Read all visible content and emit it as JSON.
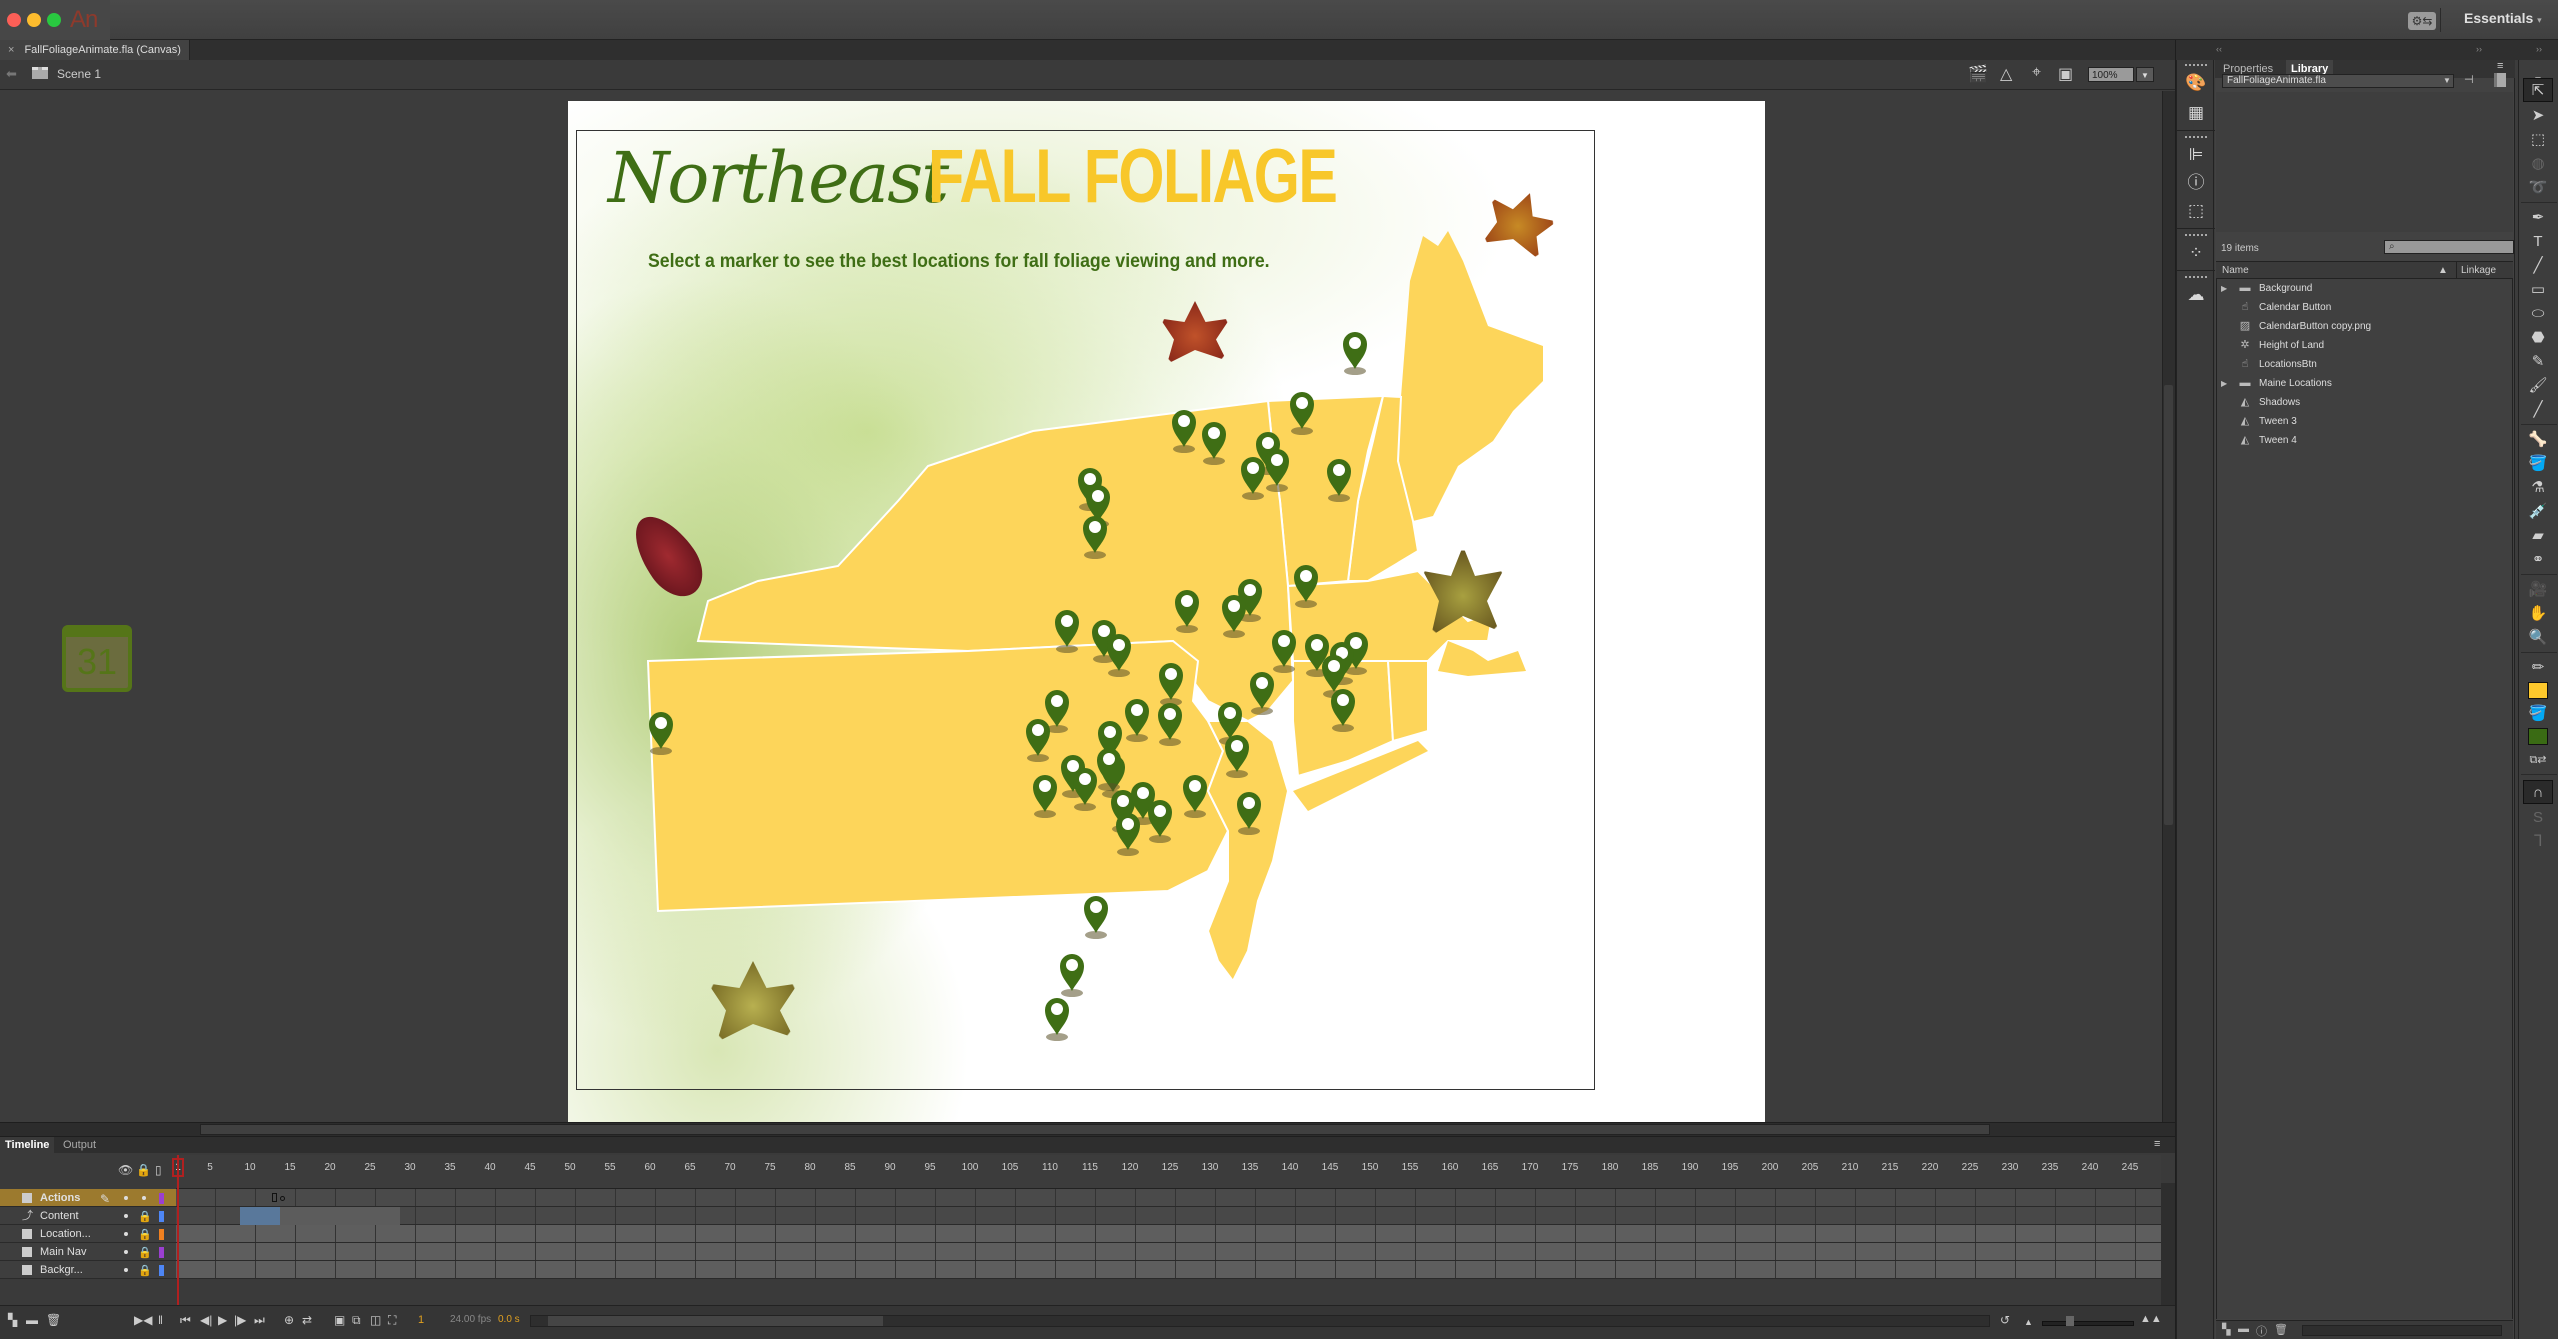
{
  "app": {
    "logo": "An",
    "workspace": "Essentials",
    "sync_icon": "sync-settings-icon"
  },
  "document": {
    "tab_label": "FallFoliageAnimate.fla (Canvas)",
    "scene": "Scene 1",
    "zoom": "100%"
  },
  "stage": {
    "title_script": "Northeast",
    "title_bold": "FALL FOLIAGE",
    "subtitle": "Select a marker to see the best locations for fall foliage viewing and more.",
    "colors": {
      "map_fill": "#fdd55a",
      "marker_green": "#3f6e15",
      "title_yellow": "#f8c72a"
    },
    "marker_count": 47
  },
  "panels": {
    "tabs": [
      "Properties",
      "Library"
    ],
    "active_tab": "Library",
    "library": {
      "document": "FallFoliageAnimate.fla",
      "item_count": "19 items",
      "search_placeholder": "",
      "columns": [
        "Name",
        "Linkage"
      ],
      "items": [
        {
          "name": "Background",
          "type": "folder",
          "expandable": true
        },
        {
          "name": "Calendar Button",
          "type": "button"
        },
        {
          "name": "CalendarButton copy.png",
          "type": "bitmap"
        },
        {
          "name": "Height of Land",
          "type": "movie-clip"
        },
        {
          "name": "LocationsBtn",
          "type": "button"
        },
        {
          "name": "Maine Locations",
          "type": "folder",
          "expandable": true
        },
        {
          "name": "Shadows",
          "type": "graphic"
        },
        {
          "name": "Tween 3",
          "type": "graphic"
        },
        {
          "name": "Tween 4",
          "type": "graphic"
        }
      ]
    }
  },
  "timeline": {
    "tabs": [
      "Timeline",
      "Output"
    ],
    "active_tab": "Timeline",
    "ruler_ticks": [
      "1",
      "5",
      "10",
      "15",
      "20",
      "25",
      "30",
      "35",
      "40",
      "45",
      "50",
      "55",
      "60",
      "65",
      "70",
      "75",
      "80",
      "85",
      "90",
      "95",
      "100",
      "105",
      "110",
      "115",
      "120",
      "125",
      "130",
      "135",
      "140",
      "145",
      "150",
      "155",
      "160",
      "165",
      "170",
      "175",
      "180",
      "185",
      "190",
      "195",
      "200",
      "205",
      "210",
      "215",
      "220",
      "225",
      "230",
      "235",
      "240",
      "245"
    ],
    "layers": [
      {
        "name": "Actions",
        "color": "#9b3fd0",
        "selected": true,
        "locked": false
      },
      {
        "name": "Content",
        "color": "#4e86f5",
        "selected": false,
        "locked": true
      },
      {
        "name": "Location...",
        "color": "#f08020",
        "selected": false,
        "locked": true
      },
      {
        "name": "Main Nav",
        "color": "#9b3fd0",
        "selected": false,
        "locked": true
      },
      {
        "name": "Backgr...",
        "color": "#4e86f5",
        "selected": false,
        "locked": true
      }
    ],
    "current_frame": "1",
    "fps": "24.00 fps",
    "elapsed": "0.0 s"
  }
}
